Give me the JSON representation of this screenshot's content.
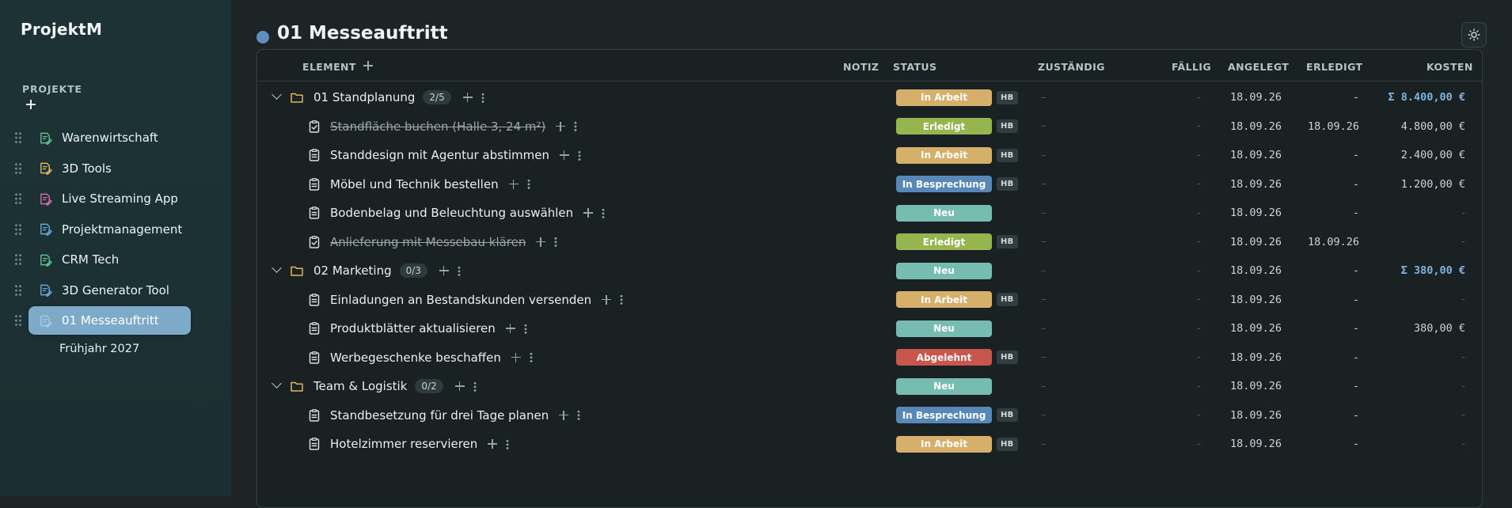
{
  "app": {
    "brand": "ProjektM"
  },
  "sidebar": {
    "section_label": "PROJEKTE",
    "projects": [
      {
        "label": "Warenwirtschaft",
        "icon_color": "#5fc08f",
        "active": false
      },
      {
        "label": "3D Tools",
        "icon_color": "#e2b55b",
        "active": false
      },
      {
        "label": "Live Streaming App",
        "icon_color": "#d26aa5",
        "active": false
      },
      {
        "label": "Projektmanagement",
        "icon_color": "#6aa6dc",
        "active": false
      },
      {
        "label": "CRM Tech",
        "icon_color": "#5fc08f",
        "active": false
      },
      {
        "label": "3D Generator Tool",
        "icon_color": "#6aa6dc",
        "active": false
      },
      {
        "label": "01 Messeauftritt",
        "icon_color": "#a9c6dc",
        "active": true
      }
    ],
    "sub_item": "Frühjahr 2027"
  },
  "main": {
    "title": "01 Messeauftritt",
    "title_dot_color": "#5f8fbf",
    "columns": {
      "element": "ELEMENT",
      "notiz": "NOTIZ",
      "status": "STATUS",
      "zustaendig": "ZUSTÄNDIG",
      "faellig": "FÄLLIG",
      "angelegt": "ANGELEGT",
      "erledigt": "ERLEDIGT",
      "kosten": "KOSTEN"
    },
    "rows": [
      {
        "type": "group",
        "title": "01 Standplanung",
        "count": "2/5",
        "status": "In Arbeit",
        "hb": "HB",
        "zustaendig": "–",
        "faellig": "-",
        "angelegt": "18.09.26",
        "erledigt": "-",
        "kosten": "Σ 8.400,00 €"
      },
      {
        "type": "task",
        "done": true,
        "title": "Standfläche buchen (Halle 3, 24 m²)",
        "status": "Erledigt",
        "hb": "HB",
        "zustaendig": "–",
        "faellig": "-",
        "angelegt": "18.09.26",
        "erledigt": "18.09.26",
        "kosten": "4.800,00 €"
      },
      {
        "type": "task",
        "done": false,
        "title": "Standdesign mit Agentur abstimmen",
        "status": "In Arbeit",
        "hb": "HB",
        "zustaendig": "–",
        "faellig": "-",
        "angelegt": "18.09.26",
        "erledigt": "-",
        "kosten": "2.400,00 €"
      },
      {
        "type": "task",
        "done": false,
        "title": "Möbel und Technik bestellen",
        "status": "In Besprechung",
        "hb": "HB",
        "zustaendig": "–",
        "faellig": "-",
        "angelegt": "18.09.26",
        "erledigt": "-",
        "kosten": "1.200,00 €"
      },
      {
        "type": "task",
        "done": false,
        "title": "Bodenbelag und Beleuchtung auswählen",
        "status": "Neu",
        "hb": "",
        "zustaendig": "–",
        "faellig": "-",
        "angelegt": "18.09.26",
        "erledigt": "-",
        "kosten": "-"
      },
      {
        "type": "task",
        "done": true,
        "title": "Anlieferung mit Messebau klären",
        "status": "Erledigt",
        "hb": "HB",
        "zustaendig": "–",
        "faellig": "-",
        "angelegt": "18.09.26",
        "erledigt": "18.09.26",
        "kosten": "-"
      },
      {
        "type": "group",
        "title": "02 Marketing",
        "count": "0/3",
        "status": "Neu",
        "hb": "",
        "zustaendig": "–",
        "faellig": "-",
        "angelegt": "18.09.26",
        "erledigt": "-",
        "kosten": "Σ 380,00 €"
      },
      {
        "type": "task",
        "done": false,
        "title": "Einladungen an Bestandskunden versenden",
        "status": "In Arbeit",
        "hb": "HB",
        "zustaendig": "–",
        "faellig": "-",
        "angelegt": "18.09.26",
        "erledigt": "-",
        "kosten": "-"
      },
      {
        "type": "task",
        "done": false,
        "title": "Produktblätter aktualisieren",
        "status": "Neu",
        "hb": "",
        "zustaendig": "–",
        "faellig": "-",
        "angelegt": "18.09.26",
        "erledigt": "-",
        "kosten": "380,00 €"
      },
      {
        "type": "task",
        "done": false,
        "title": "Werbegeschenke beschaffen",
        "status": "Abgelehnt",
        "hb": "HB",
        "zustaendig": "–",
        "faellig": "-",
        "angelegt": "18.09.26",
        "erledigt": "-",
        "kosten": "-"
      },
      {
        "type": "group",
        "title": "Team & Logistik",
        "count": "0/2",
        "status": "Neu",
        "hb": "",
        "zustaendig": "–",
        "faellig": "-",
        "angelegt": "18.09.26",
        "erledigt": "-",
        "kosten": "-"
      },
      {
        "type": "task",
        "done": false,
        "title": "Standbesetzung für drei Tage planen",
        "status": "In Besprechung",
        "hb": "HB",
        "zustaendig": "–",
        "faellig": "-",
        "angelegt": "18.09.26",
        "erledigt": "-",
        "kosten": "-"
      },
      {
        "type": "task",
        "done": false,
        "title": "Hotelzimmer reservieren",
        "status": "In Arbeit",
        "hb": "HB",
        "zustaendig": "–",
        "faellig": "-",
        "angelegt": "18.09.26",
        "erledigt": "-",
        "kosten": "-"
      }
    ]
  },
  "status_colors": {
    "In Arbeit": "#d6b06a",
    "Erledigt": "#97b54f",
    "In Besprechung": "#5888b8",
    "Neu": "#76bcb1",
    "Abgelehnt": "#c8564d"
  },
  "folder_color": "#e2b55b"
}
